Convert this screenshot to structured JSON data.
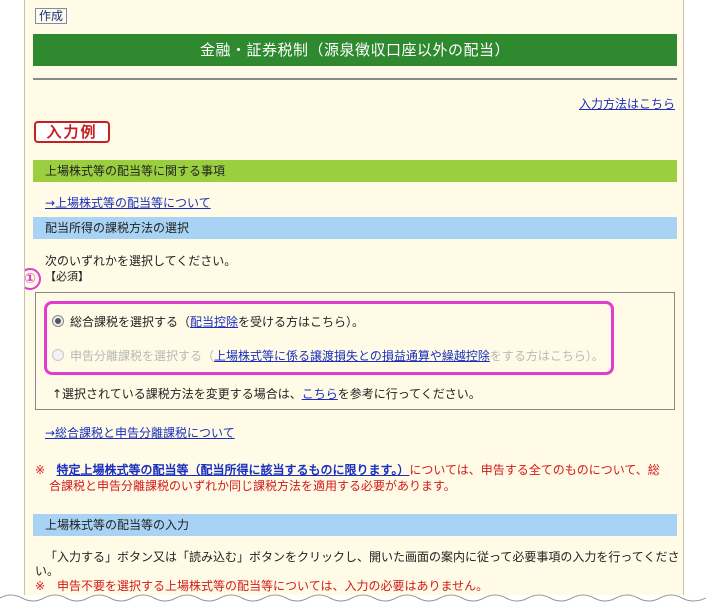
{
  "tab_created": "作成",
  "title": "金融・証券税制（源泉徴収口座以外の配当）",
  "howto_link": "入力方法はこちら",
  "example_badge": "入力例",
  "section1": {
    "heading": "上場株式等の配当等に関する事項",
    "link": "→上場株式等の配当等について"
  },
  "section2": {
    "heading": "配当所得の課税方法の選択",
    "instruction": "次のいずれかを選択してください。",
    "required": "【必須】",
    "marker": "①",
    "option1": {
      "prefix": "総合課税を選択する（",
      "link": "配当控除",
      "suffix": "を受ける方はこちら）。",
      "checked": true
    },
    "option2": {
      "prefix": "申告分離課税を選択する（",
      "link": "上場株式等に係る譲渡損失との損益通算や繰越控除",
      "suffix": "をする方はこちら）。",
      "checked": false
    },
    "change_note_prefix": "↑選択されている課税方法を変更する場合は、",
    "change_note_link": "こちら",
    "change_note_suffix": "を参考に行ってください。",
    "link_about": "→総合課税と申告分離課税について"
  },
  "notice": {
    "mark": "※",
    "emphasis": "特定上場株式等の配当等（配当所得に該当するものに限ります。）",
    "line1_rest": "については、申告する全てのものについて、総",
    "line2": "合課税と申告分離課税のいずれか同じ課税方法を適用する必要があります。"
  },
  "section3": {
    "heading": "上場株式等の配当等の入力",
    "body": "「入力する」ボタン又は「読み込む」ボタンをクリックし、開いた画面の案内に従って必要事項の入力を行ってくださ",
    "body_cont": "い。",
    "red_note": "※　申告不要を選択する上場株式等の配当等については、入力の必要はありません。"
  },
  "colors": {
    "title_bar": "#2f8a2f",
    "green_head": "#9ccf3f",
    "blue_head": "#a9d3f5",
    "highlight": "#e03cd0",
    "link": "#1a2fbf",
    "warning": "#d21a1a"
  }
}
